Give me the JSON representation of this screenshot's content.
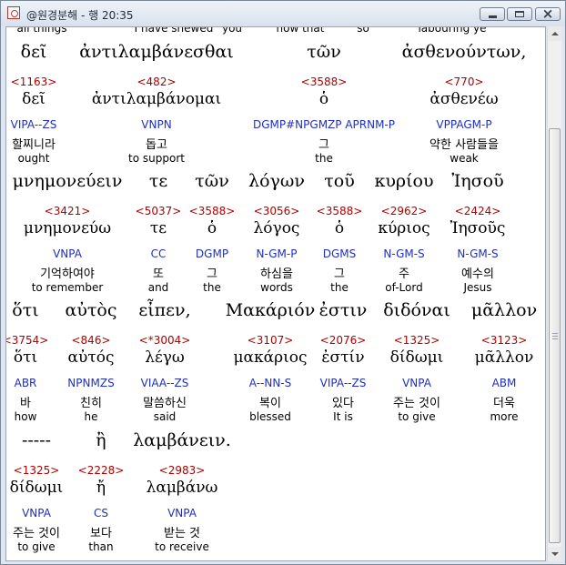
{
  "window": {
    "title": "@원경분해 - 행 20:35"
  },
  "top_partial": [
    "all things",
    "I have shewed",
    "you",
    "how that",
    "so",
    "labouring ye"
  ],
  "blocks": [
    {
      "words": [
        {
          "greek": "δεῖ",
          "strong": "<1163>",
          "lemma": "δεῖ",
          "parse": "VIPA--ZS",
          "korean": "할찌니라",
          "english": "ought"
        },
        {
          "greek": "ἀντιλαμβάνεσθαι",
          "strong": "<482>",
          "lemma": "ἀντιλαμβάνομαι",
          "parse": "VNPN",
          "korean": "돕고",
          "english": "to support"
        },
        {
          "greek": "τῶν",
          "strong": "<3588>",
          "lemma": "ὁ",
          "parse": "DGMP#NPGMZP APRNM-P",
          "korean": "그",
          "english": "the"
        },
        {
          "greek": "ἀσθενούντων,",
          "strong": "<770>",
          "lemma": "ἀσθενέω",
          "parse": "VPPAGM-P",
          "korean": "약한 사람들을",
          "english": "weak"
        }
      ]
    },
    {
      "words": [
        {
          "greek": "μνημονεύειν",
          "strong": "<3421>",
          "lemma": "μνημονεύω",
          "parse": "VNPA",
          "korean": "기억하여야",
          "english": "to remember"
        },
        {
          "greek": "τε",
          "strong": "<5037>",
          "lemma": "τε",
          "parse": "CC",
          "korean": "또",
          "english": "and"
        },
        {
          "greek": "τῶν",
          "strong": "<3588>",
          "lemma": "ὁ",
          "parse": "DGMP",
          "korean": "그",
          "english": "the"
        },
        {
          "greek": "λόγων",
          "strong": "<3056>",
          "lemma": "λόγος",
          "parse": "N-GM-P",
          "korean": "하심을",
          "english": "words"
        },
        {
          "greek": "τοῦ",
          "strong": "<3588>",
          "lemma": "ὁ",
          "parse": "DGMS",
          "korean": "그",
          "english": "the"
        },
        {
          "greek": "κυρίου",
          "strong": "<2962>",
          "lemma": "κύριος",
          "parse": "N-GM-S",
          "korean": "주",
          "english": "of-Lord"
        },
        {
          "greek": "Ἰησοῦ",
          "strong": "<2424>",
          "lemma": "Ἰησοῦς",
          "parse": "N-GM-S",
          "korean": "예수의",
          "english": "Jesus"
        }
      ]
    },
    {
      "words": [
        {
          "greek": "ὅτι",
          "strong": "<3754>",
          "lemma": "ὅτι",
          "parse": "ABR",
          "korean": "바",
          "english": "how"
        },
        {
          "greek": "αὐτὸς",
          "strong": "<846>",
          "lemma": "αὐτός",
          "parse": "NPNMZS",
          "korean": "친히",
          "english": "he"
        },
        {
          "greek": "εἶπεν,",
          "strong": "<*3004>",
          "lemma": "λέγω",
          "parse": "VIAA--ZS",
          "korean": "말씀하신",
          "english": "said"
        },
        {
          "greek": "Μακάριόν",
          "strong": "<3107>",
          "lemma": "μακάριος",
          "parse": "A--NN-S",
          "korean": "복이",
          "english": "blessed"
        },
        {
          "greek": "ἐστιν",
          "strong": "<2076>",
          "lemma": "ἐστίν",
          "parse": "VIPA--ZS",
          "korean": "있다",
          "english": "It is"
        },
        {
          "greek": "διδόναι",
          "strong": "<1325>",
          "lemma": "δίδωμι",
          "parse": "VNPA",
          "korean": "주는 것이",
          "english": "to give"
        },
        {
          "greek": "μᾶλλον",
          "strong": "<3123>",
          "lemma": "μᾶλλον",
          "parse": "ABM",
          "korean": "더욱",
          "english": "more"
        }
      ]
    },
    {
      "words": [
        {
          "greek": "-----",
          "strong": "<1325>",
          "lemma": "δίδωμι",
          "parse": "VNPA",
          "korean": "주는 것이",
          "english": "to give"
        },
        {
          "greek": "ἢ",
          "strong": "<2228>",
          "lemma": "ἤ",
          "parse": "CS",
          "korean": "보다",
          "english": "than"
        },
        {
          "greek": "λαμβάνειν.",
          "strong": "<2983>",
          "lemma": "λαμβάνω",
          "parse": "VNPA",
          "korean": "받는 것",
          "english": "to receive"
        }
      ]
    }
  ]
}
